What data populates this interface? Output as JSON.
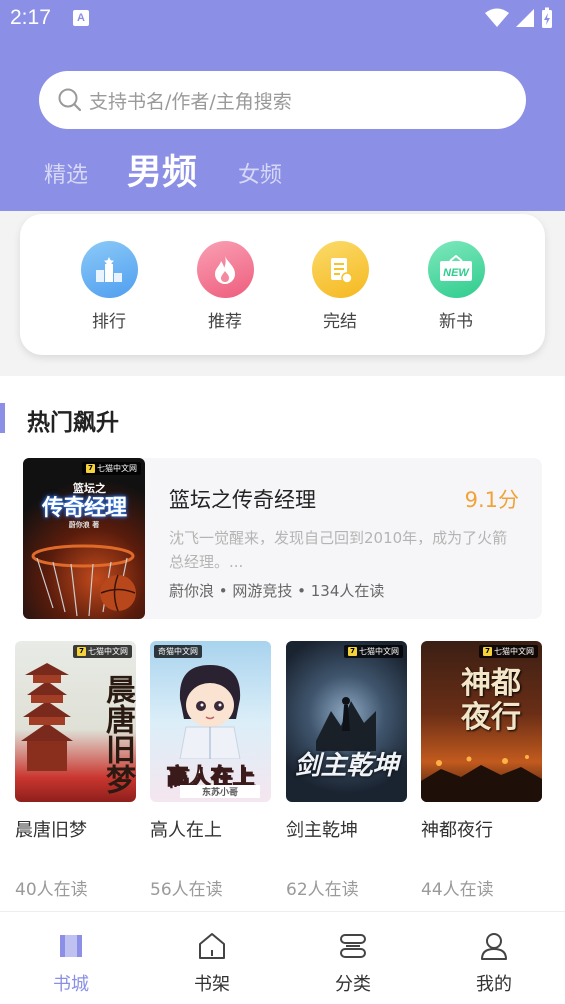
{
  "status_bar": {
    "time": "2:17",
    "icons": [
      "notification-a-icon",
      "wifi-icon",
      "signal-icon",
      "battery-charging-icon"
    ]
  },
  "search": {
    "placeholder": "支持书名/作者/主角搜索",
    "icon": "search-icon"
  },
  "tabs": [
    {
      "label": "精选",
      "active": false
    },
    {
      "label": "男频",
      "active": true
    },
    {
      "label": "女频",
      "active": false
    }
  ],
  "categories": [
    {
      "label": "排行",
      "icon": "podium-icon",
      "color": "#5aa7f0"
    },
    {
      "label": "推荐",
      "icon": "flame-icon",
      "color": "#f06b87"
    },
    {
      "label": "完结",
      "icon": "document-check-icon",
      "color": "#f5c42a"
    },
    {
      "label": "新书",
      "icon": "new-sign-icon",
      "color": "#3ed29a"
    }
  ],
  "section": {
    "title": "热门飙升"
  },
  "featured": {
    "title": "篮坛之传奇经理",
    "score": "9.1分",
    "description": "沈飞一觉醒来，发现自己回到2010年，成为了火箭总经理。...",
    "meta": "蔚你浪 • 网游竞技 • 134人在读",
    "cover": {
      "badge": "七猫中文网",
      "top_text": "篮坛之",
      "main_text": "传奇经理",
      "author": "蔚你浪 著"
    }
  },
  "books": [
    {
      "title": "晨唐旧梦",
      "readers": "40人在读",
      "cover_text": "晨唐旧梦",
      "badge": "七猫中文网"
    },
    {
      "title": "高人在上",
      "readers": "56人在读",
      "cover_text": "高人在上",
      "badge": "奇猫中文网",
      "cover_author": "东苏小哥"
    },
    {
      "title": "剑主乾坤",
      "readers": "62人在读",
      "cover_text": "剑主乾坤",
      "badge": "七猫中文网"
    },
    {
      "title": "神都夜行",
      "readers": "44人在读",
      "cover_text": "神都夜行",
      "badge": "七猫中文网"
    }
  ],
  "bottom_nav": [
    {
      "label": "书城",
      "icon": "book-city-icon",
      "active": true
    },
    {
      "label": "书架",
      "icon": "bookshelf-house-icon",
      "active": false
    },
    {
      "label": "分类",
      "icon": "category-stack-icon",
      "active": false
    },
    {
      "label": "我的",
      "icon": "profile-icon",
      "active": false
    }
  ],
  "colors": {
    "accent": "#8b8fe6",
    "score": "#f0a338"
  }
}
